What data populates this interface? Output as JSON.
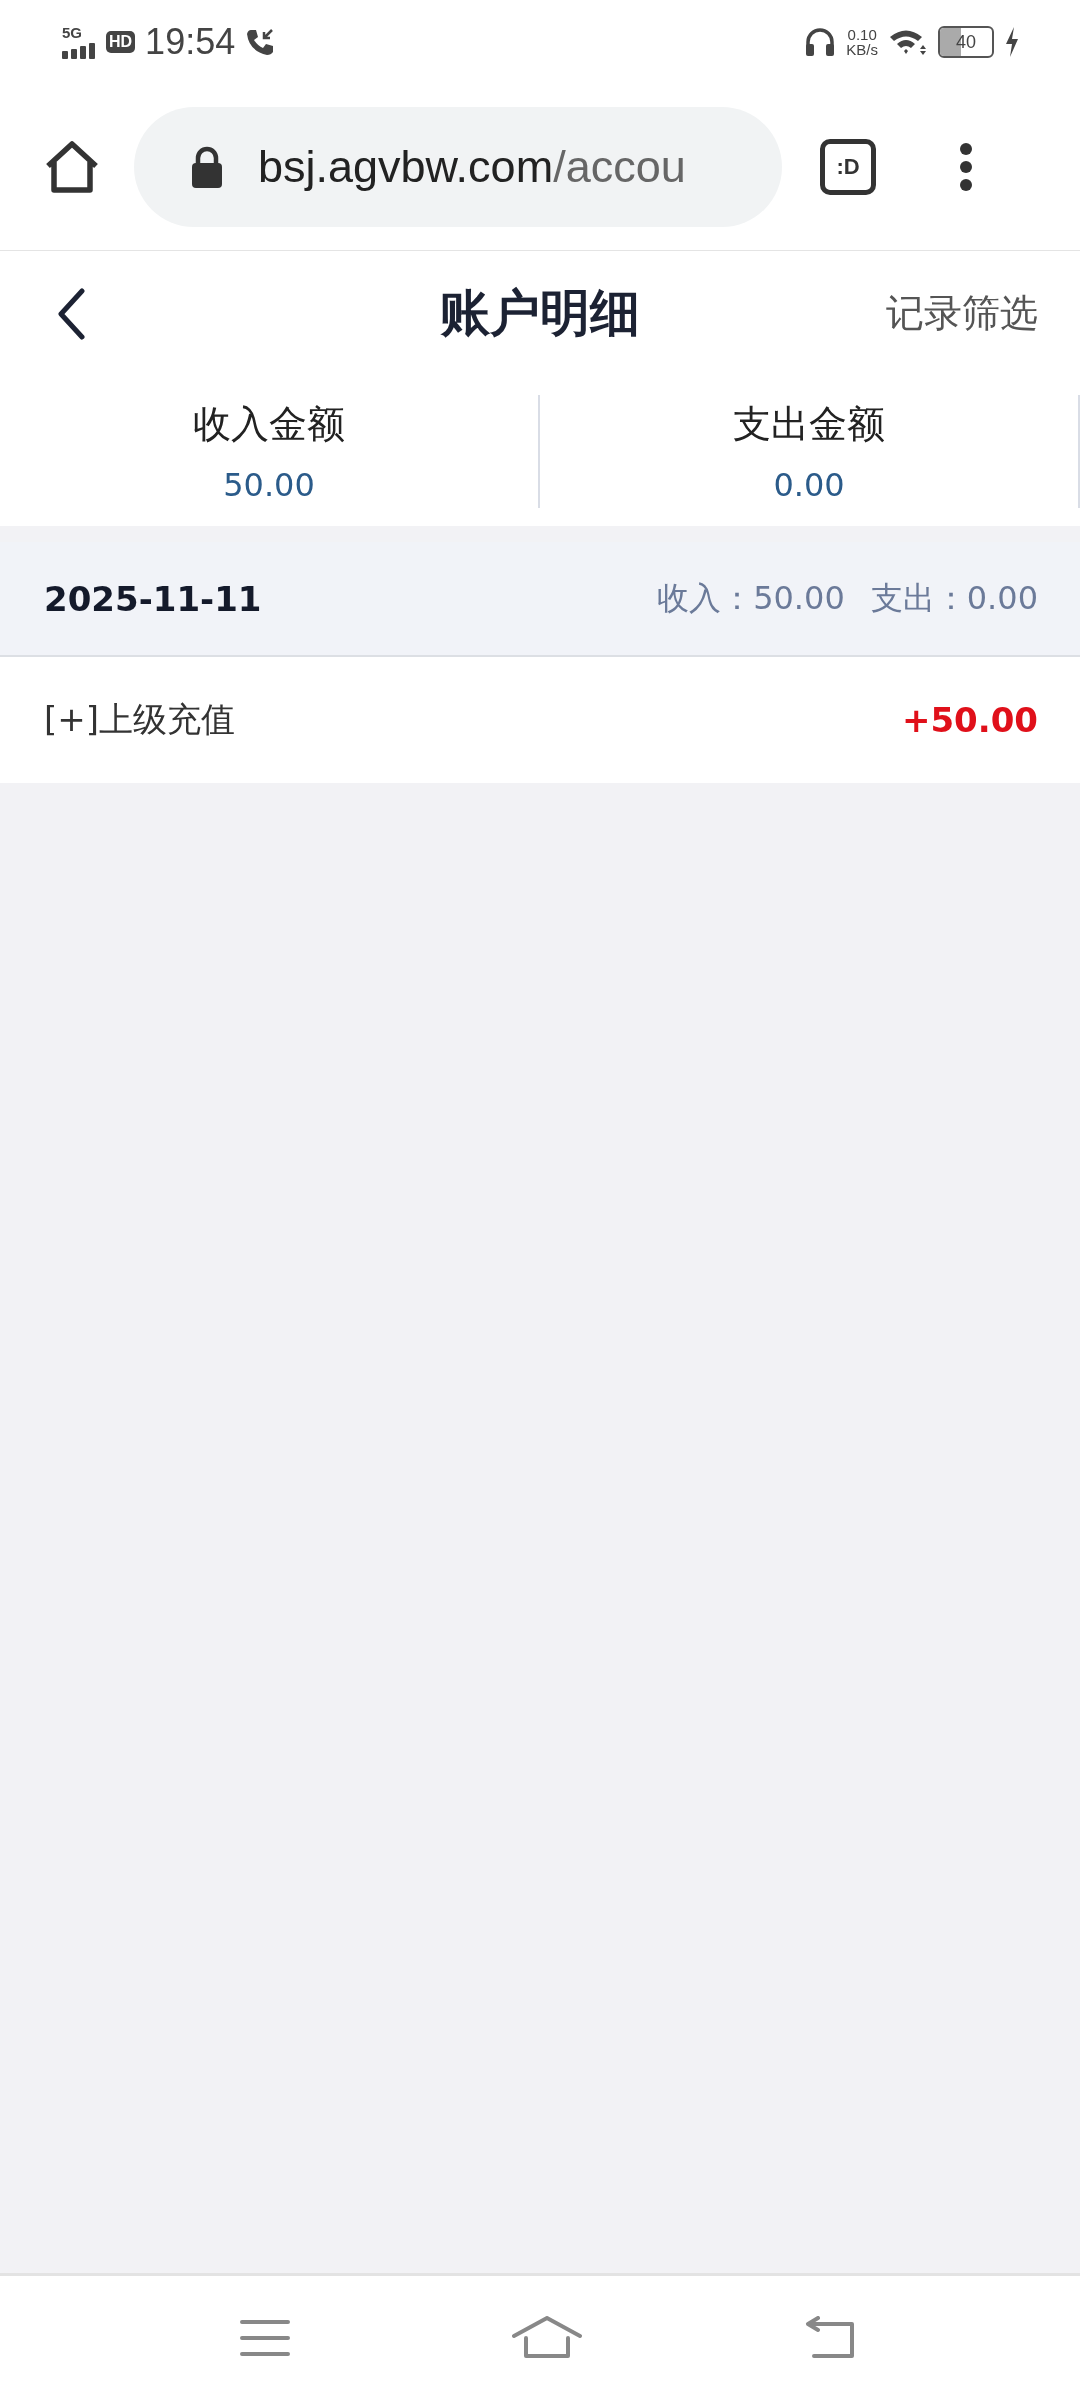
{
  "status_bar": {
    "network": "5G",
    "hd": "HD",
    "time": "19:54",
    "speed_value": "0.10",
    "speed_unit": "KB/s",
    "battery": "40"
  },
  "browser": {
    "url_host": "bsj.agvbw.com",
    "url_path": "/accou",
    "tab_label": ":D"
  },
  "header": {
    "title": "账户明细",
    "action": "记录筛选"
  },
  "summary": [
    {
      "label": "收入金额",
      "value": "50.00"
    },
    {
      "label": "支出金额",
      "value": "0.00"
    }
  ],
  "groups": [
    {
      "date": "2025-11-11",
      "income": "收入：50.00",
      "expense": "支出：0.00",
      "records": [
        {
          "name": "[+]上级充值",
          "amount": "+50.00",
          "kind": "credit"
        }
      ]
    }
  ]
}
